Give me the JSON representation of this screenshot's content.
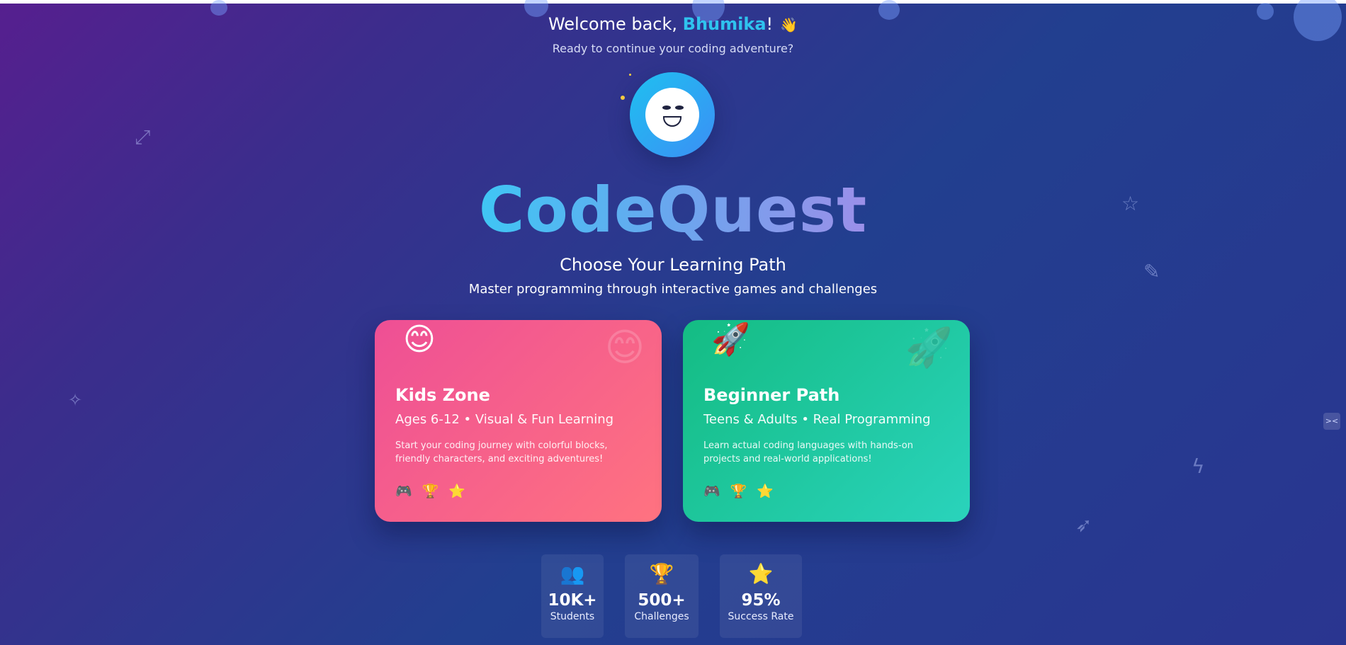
{
  "header": {
    "welcome_prefix": "Welcome back, ",
    "user_name": "Bhumika",
    "welcome_suffix": "!",
    "wave_emoji": "👋",
    "subtitle": "Ready to continue your coding adventure?"
  },
  "mascot": {
    "icon": "smiling-robot-face"
  },
  "brand": {
    "name": "CodeQuest"
  },
  "intro": {
    "title": "Choose Your Learning Path",
    "subtitle": "Master programming through interactive games and challenges"
  },
  "cards": [
    {
      "emoji": "😊",
      "title": "Kids Zone",
      "tagline": "Ages 6-12 • Visual & Fun Learning",
      "description": "Start your coding journey with colorful blocks, friendly characters, and exciting adventures!",
      "icons": [
        "🎮",
        "🏆",
        "⭐"
      ],
      "color_start": "#ee4f95",
      "color_end": "#ff7380"
    },
    {
      "emoji": "🚀",
      "title": "Beginner Path",
      "tagline": "Teens & Adults • Real Programming",
      "description": "Learn actual coding languages with hands-on projects and real-world applications!",
      "icons": [
        "🎮",
        "🏆",
        "⭐"
      ],
      "color_start": "#14bc83",
      "color_end": "#2ad3bc"
    }
  ],
  "stats": [
    {
      "icon": "👥",
      "value": "10K+",
      "label": "Students"
    },
    {
      "icon": "🏆",
      "value": "500+",
      "label": "Challenges"
    },
    {
      "icon": "⭐",
      "value": "95%",
      "label": "Success Rate"
    }
  ],
  "colors": {
    "accent": "#2fc3ee",
    "background_start": "#561f8f",
    "background_end": "#223f8f"
  }
}
